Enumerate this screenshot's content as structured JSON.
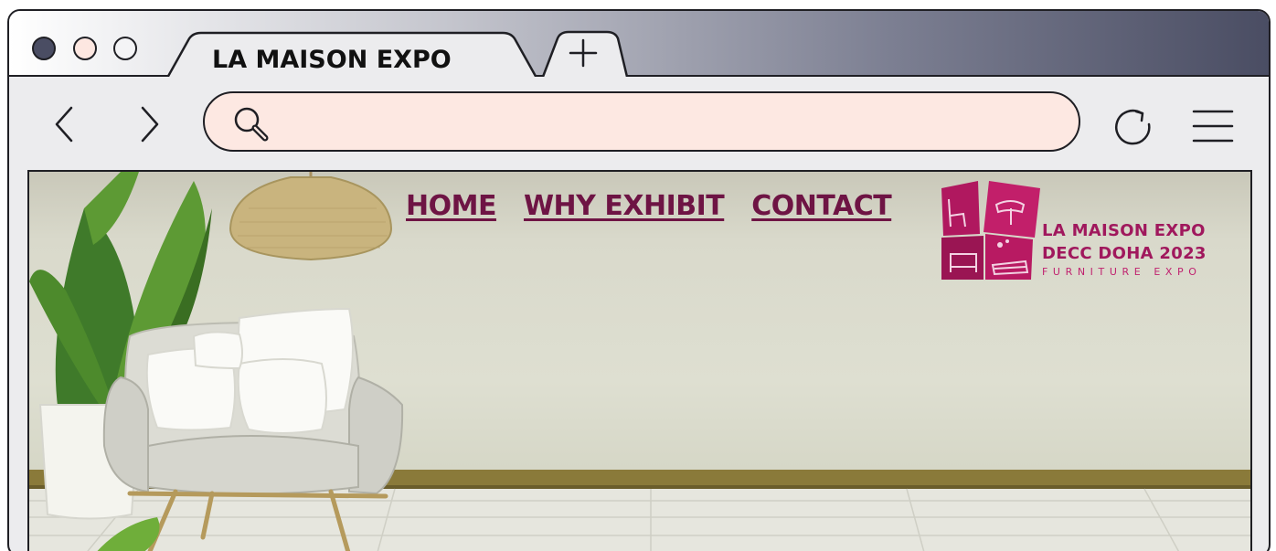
{
  "browser": {
    "tab_title": "LA MAISON EXPO",
    "new_tab_symbol": "+",
    "address_value": "",
    "icons": [
      "back-arrow-icon",
      "forward-arrow-icon",
      "search-icon",
      "reload-icon",
      "hamburger-menu-icon",
      "new-tab-icon"
    ],
    "colors": {
      "titlebar_dark": "#4a4d63",
      "address_bar": "#fde8e2",
      "window_chrome": "#ececee"
    }
  },
  "site": {
    "nav": [
      {
        "label": "HOME"
      },
      {
        "label": "WHY EXHIBIT"
      },
      {
        "label": "CONTACT"
      }
    ],
    "logo": {
      "line1": "LA MAISON EXPO",
      "line2": "DECC DOHA 2023",
      "line3": "FURNITURE EXPO"
    },
    "colors": {
      "brand": "#a0185d",
      "nav_link": "#6e1444"
    }
  }
}
